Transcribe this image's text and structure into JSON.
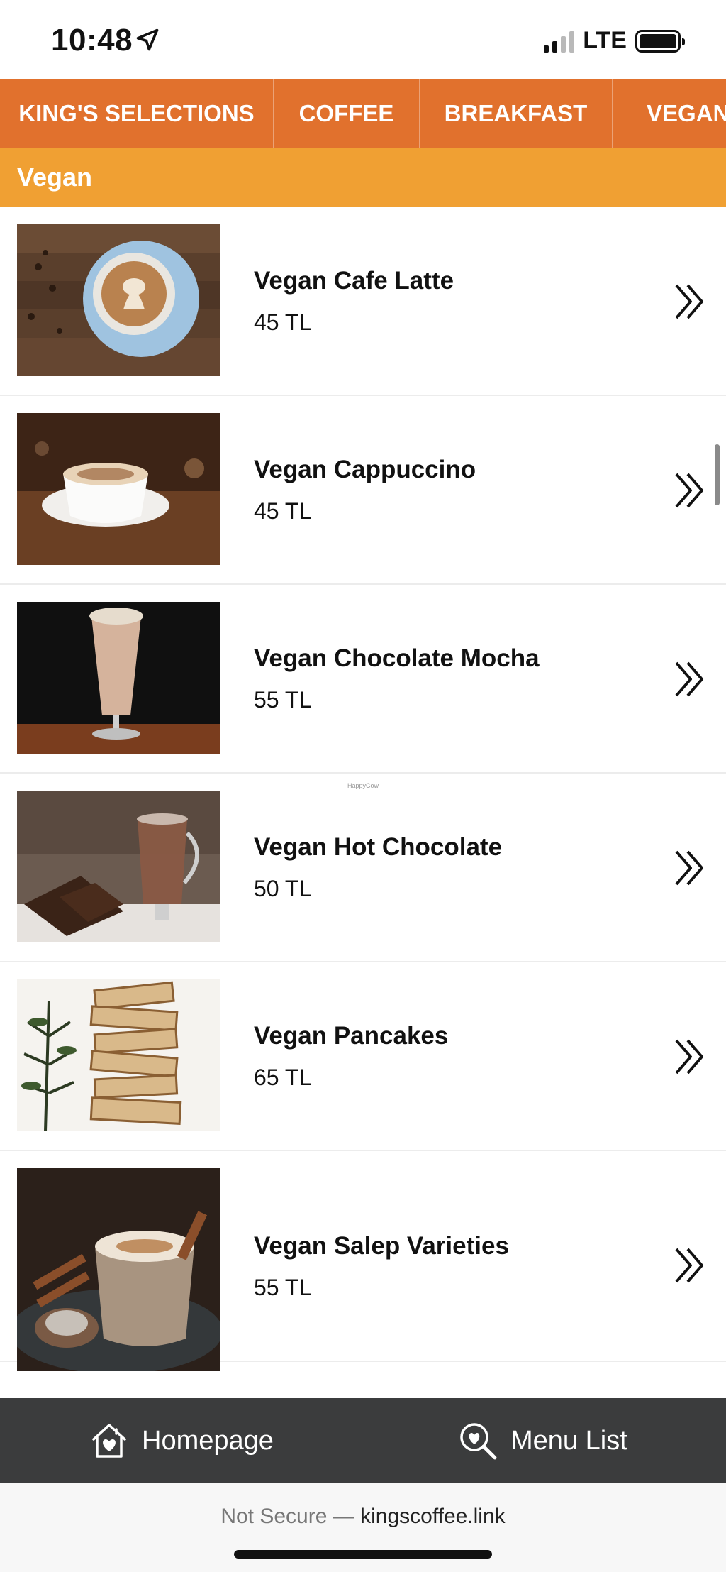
{
  "status": {
    "time": "10:48",
    "network": "LTE"
  },
  "tabs": [
    {
      "label": "KING'S SELECTIONS"
    },
    {
      "label": "COFFEE"
    },
    {
      "label": "BREAKFAST"
    },
    {
      "label": "VEGAN"
    }
  ],
  "section": {
    "title": "Vegan"
  },
  "items": [
    {
      "name": "Vegan Cafe Latte",
      "price": "45 TL"
    },
    {
      "name": "Vegan Cappuccino",
      "price": "45 TL"
    },
    {
      "name": "Vegan Chocolate Mocha",
      "price": "55 TL"
    },
    {
      "name": "Vegan Hot Chocolate",
      "price": "50 TL"
    },
    {
      "name": "Vegan Pancakes",
      "price": "65 TL"
    },
    {
      "name": "Vegan Salep Varieties",
      "price": "55 TL"
    }
  ],
  "watermark": "HappyCow",
  "bottom_nav": {
    "home_label": "Homepage",
    "menu_label": "Menu List"
  },
  "browser": {
    "security": "Not Secure —",
    "domain": "kingscoffee.link"
  },
  "colors": {
    "tab_bar": "#e1712d",
    "section_header": "#f0a033",
    "bottom_nav": "#3b3c3d"
  }
}
